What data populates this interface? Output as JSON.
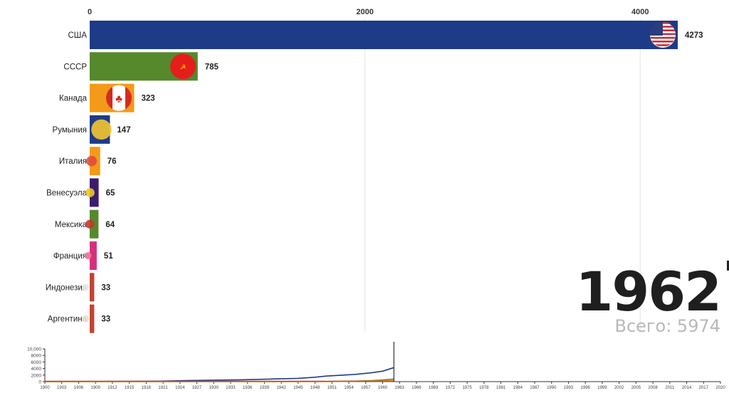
{
  "chart_data": [
    {
      "type": "bar",
      "orientation": "horizontal",
      "xlim": [
        0,
        4273
      ],
      "x_ticks": [
        0,
        2000,
        4000
      ],
      "grid": true,
      "categories": [
        "США",
        "СССР",
        "Канада",
        "Румыния",
        "Италия",
        "Венесуэла",
        "Мексика",
        "Франция",
        "Индонезия",
        "Аргентина"
      ],
      "values": [
        4273,
        785,
        323,
        147,
        76,
        65,
        64,
        51,
        33,
        33
      ],
      "value_labels": [
        "4273",
        "785",
        "323",
        "147",
        "76",
        "65",
        "64",
        "51",
        "33",
        "33"
      ],
      "colors": [
        "#1d3b87",
        "#55892c",
        "#f39a18",
        "#1d3b87",
        "#f39a18",
        "#3a1d6e",
        "#55892c",
        "#d6307a",
        "#c44332",
        "#c44332"
      ],
      "flag_icons": [
        "usa-flag-icon",
        "ussr-flag-icon",
        "canada-flag-icon",
        "romania-flag-icon",
        "italy-flag-icon",
        "venezuela-flag-icon",
        "mexico-flag-icon",
        "france-flag-icon",
        "indonesia-flag-icon",
        "argentina-flag-icon"
      ]
    },
    {
      "type": "line",
      "x_ticks": [
        "1900",
        "1903",
        "1906",
        "1909",
        "1912",
        "1915",
        "1918",
        "1921",
        "1924",
        "1927",
        "1930",
        "1933",
        "1936",
        "1939",
        "1942",
        "1945",
        "1948",
        "1951",
        "1954",
        "1957",
        "1960",
        "1963",
        "1966",
        "1969",
        "1972",
        "1975",
        "1978",
        "1981",
        "1984",
        "1987",
        "1990",
        "1993",
        "1996",
        "1999",
        "2002",
        "2005",
        "2008",
        "2011",
        "2014",
        "2017",
        "2020"
      ],
      "y_ticks": [
        "0",
        "2000",
        "4000",
        "6000",
        "8000",
        "10,000"
      ],
      "ylim": [
        0,
        10000
      ],
      "current_year": 1962,
      "series": [
        {
          "color": "#1d3b87",
          "x": [
            1900,
            1910,
            1920,
            1925,
            1930,
            1935,
            1940,
            1945,
            1948,
            1950,
            1955,
            1958,
            1960,
            1962
          ],
          "values": [
            10,
            40,
            140,
            320,
            460,
            560,
            780,
            1000,
            1350,
            1700,
            2200,
            2700,
            3200,
            4273
          ]
        },
        {
          "color": "#55892c",
          "x": [
            1900,
            1940,
            1950,
            1955,
            1958,
            1960,
            1962
          ],
          "values": [
            0,
            10,
            50,
            150,
            300,
            500,
            785
          ]
        },
        {
          "color": "#f39a18",
          "x": [
            1900,
            1945,
            1950,
            1955,
            1960,
            1962
          ],
          "values": [
            0,
            5,
            30,
            120,
            250,
            323
          ]
        },
        {
          "color": "#c44332",
          "x": [
            1900,
            1962
          ],
          "values": [
            100,
            100
          ]
        }
      ]
    }
  ],
  "year_label": "1962",
  "total_label": "Всего: 5974"
}
